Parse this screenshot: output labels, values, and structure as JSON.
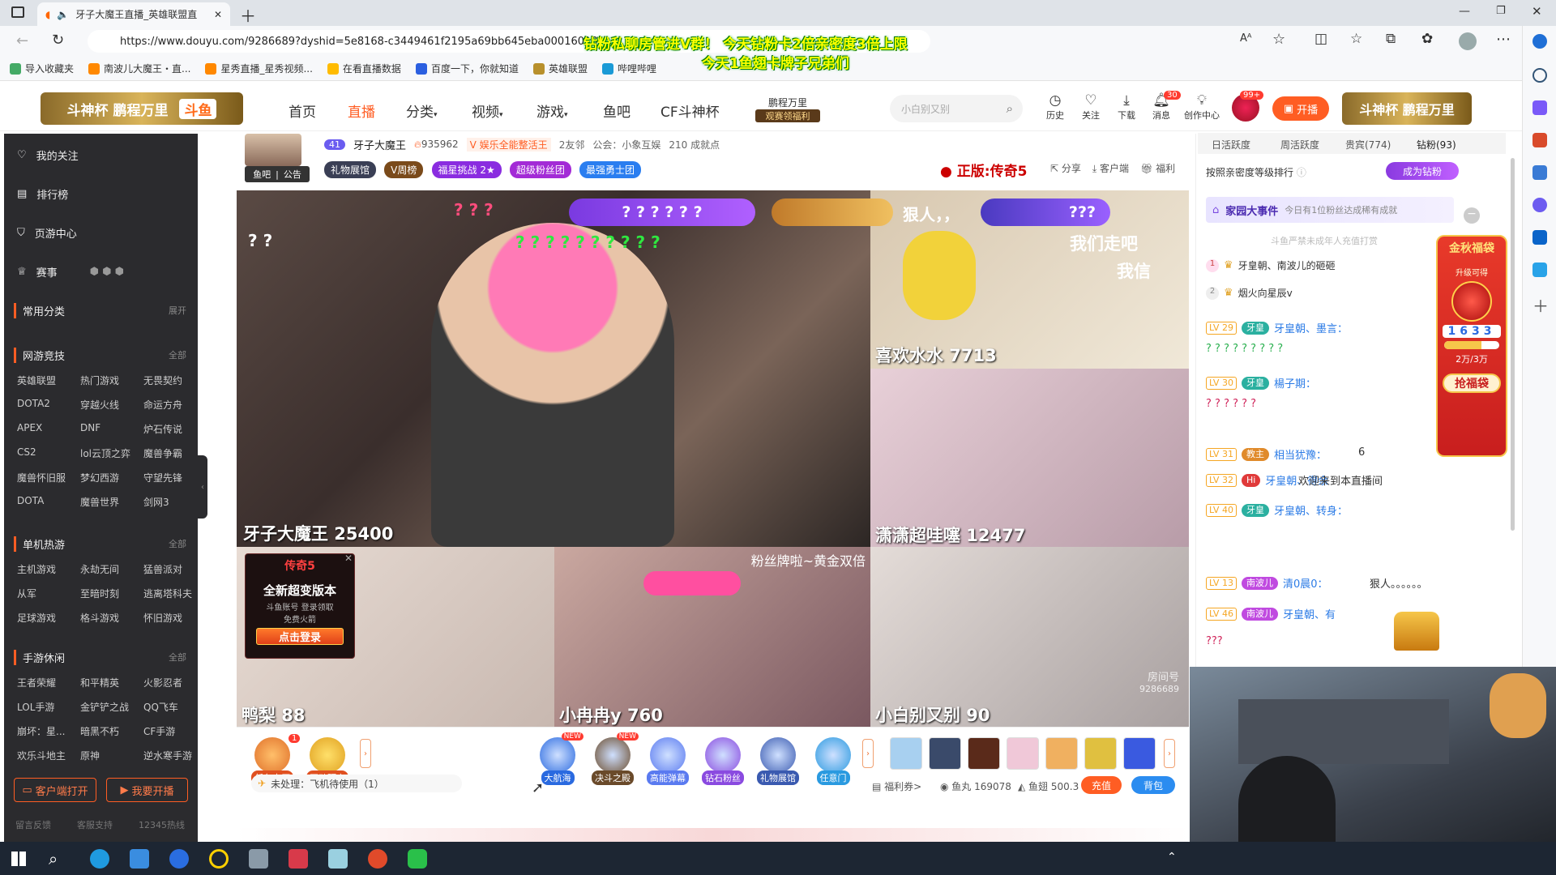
{
  "browser": {
    "tab_title": "牙子大魔王直播_英雄联盟直",
    "url": "https://www.douyu.com/9286689?dyshid=5e8168-c3449461f2195a69bb645eba00016018",
    "favorites": [
      "导入收藏夹",
      "南波儿大魔王・直...",
      "星秀直播_星秀视频...",
      "在看直播数据",
      "百度一下，你就知道",
      "英雄联盟",
      "哔哩哔哩"
    ]
  },
  "overlay": {
    "line1": "钻粉私聊房管进V群！ 今天钻粉卡2倍亲密度3倍上限",
    "line2": "今天1鱼翅卡牌子兄弟们"
  },
  "header": {
    "logo_left": "斗神杯 鹏程万里",
    "logo": "斗鱼",
    "nav": [
      "首页",
      "直播",
      "分类",
      "视频",
      "游戏",
      "鱼吧",
      "CF斗神杯"
    ],
    "promo_title": "鹏程万里",
    "promo_sub": "观赛领福利",
    "search_placeholder": "小白别又别",
    "icons": [
      "历史",
      "关注",
      "下载",
      "消息",
      "创作中心"
    ],
    "msg_badge": "30",
    "avatar_badge": "99+",
    "live_button": "开播",
    "logo_right": "斗神杯 鹏程万里"
  },
  "sidebar": {
    "top": [
      "我的关注",
      "排行榜",
      "页游中心",
      "赛事"
    ],
    "common": {
      "title": "常用分类",
      "more": "展开"
    },
    "sections": [
      {
        "title": "网游竞技",
        "more": "全部",
        "items": [
          "英雄联盟",
          "热门游戏",
          "无畏契约",
          "DOTA2",
          "穿越火线",
          "命运方舟",
          "APEX",
          "DNF",
          "炉石传说",
          "CS2",
          "lol云顶之弈",
          "魔兽争霸",
          "魔兽怀旧服",
          "梦幻西游",
          "守望先锋",
          "DOTA",
          "魔兽世界",
          "剑网3"
        ]
      },
      {
        "title": "单机热游",
        "more": "全部",
        "items": [
          "主机游戏",
          "永劫无间",
          "猛兽派对",
          "从军",
          "至暗时刻",
          "逃离塔科夫",
          "足球游戏",
          "格斗游戏",
          "怀旧游戏"
        ]
      },
      {
        "title": "手游休闲",
        "more": "全部",
        "items": [
          "王者荣耀",
          "和平精英",
          "火影忍者",
          "LOL手游",
          "金铲铲之战",
          "QQ飞车",
          "崩坏：星...",
          "暗黑不朽",
          "CF手游",
          "欢乐斗地主",
          "原神",
          "逆水寒手游"
        ]
      }
    ],
    "btn_client": "客户端打开",
    "btn_live": "我要开播",
    "footer": [
      "留言反馈",
      "客服支持",
      "12345热线"
    ]
  },
  "room": {
    "level": "41",
    "name": "牙子大魔王",
    "heat": "935962",
    "category": "娱乐全能整活王",
    "friends": "2友邻",
    "guild": "公会：小象互娱",
    "achievements": "210 成就点",
    "fishbar": "鱼吧",
    "notice": "公告",
    "tags": [
      "礼物展馆",
      "V周榜",
      "福星挑战 2★",
      "超级粉丝团",
      "最强勇士团"
    ],
    "ad_text": "正版:传奇5",
    "actions": [
      "分享",
      "客户端",
      "福利"
    ]
  },
  "video": {
    "cells": [
      {
        "name": "牙子大魔王 25400"
      },
      {
        "name": "喜欢水水 7713"
      },
      {
        "name": "潇潇超哇噻 12477"
      },
      {
        "name": "鸭梨 88"
      },
      {
        "name": "小冉冉y 760"
      },
      {
        "name": "小白别又别 90"
      }
    ],
    "top_bubble1": "? ? ? ? ? ?",
    "top_bubble2": "???",
    "q_top_left": "? ?",
    "q_green": "? ? ? ? ? ? ? ? ? ?",
    "q_red": "? ? ?",
    "text_lang": "狠人，，",
    "text_zoumen": "我们走吧",
    "text_woxin": "我信",
    "fans_banner": "粉丝牌啦~黄金双倍",
    "room_no_label": "房间号",
    "room_no": "9286689",
    "popup": {
      "title": "全新超变版本",
      "opt1": "斗鱼账号",
      "opt2": "登录领取",
      "opt3": "免费火箭",
      "btn": "点击登录",
      "logo": "传奇5"
    }
  },
  "toolbar": {
    "left_icons": [
      {
        "label": "任务大厅",
        "badge": "1"
      },
      {
        "label": "互动预言"
      }
    ],
    "middle_icons": [
      {
        "label": "大航海",
        "new": "NEW"
      },
      {
        "label": "决斗之殿",
        "new": "NEW"
      },
      {
        "label": "高能弹幕"
      },
      {
        "label": "钻石粉丝"
      },
      {
        "label": "礼物展馆"
      },
      {
        "label": "任意门"
      }
    ],
    "task": "未处理：飞机待使用（1）",
    "welfare": "福利券>",
    "fish_pill": "鱼丸 169078",
    "fish_fin": "鱼翅 500.3",
    "recharge": "充值",
    "bag": "背包"
  },
  "chat": {
    "tabs": [
      "日活跃度",
      "周活跃度",
      "贵宾(774)",
      "钻粉(93)"
    ],
    "sort": "按照亲密度等级排行",
    "become_diamond": "成为钻粉",
    "event_title": "家园大事件",
    "event_desc": "今日有1位粉丝达成稀有成就",
    "notice": "斗鱼严禁未成年人充值打赏",
    "rank": [
      {
        "no": "1",
        "name": "牙皇朝、南波儿的砸砸"
      },
      {
        "no": "2",
        "name": "烟火向星辰v"
      }
    ],
    "messages": [
      {
        "lv": "LV 29",
        "user": "牙皇朝、墨言：",
        "text": "? ? ? ? ? ? ? ? ?"
      },
      {
        "lv": "LV 30",
        "user": "楊子期：",
        "text": "? ? ? ? ? ?"
      },
      {
        "lv": "LV 31",
        "user": "相当犹豫：",
        "text": "6"
      },
      {
        "lv": "LV 32",
        "user": "牙皇朝、得余",
        "text": "欢迎来到本直播间"
      },
      {
        "lv": "LV 40",
        "user": "牙皇朝、转身：",
        "text": ""
      },
      {
        "lv": "LV 13",
        "user": "清0晨0：",
        "text": "狠人。。。。。。"
      },
      {
        "lv": "LV 46",
        "user": "牙皇朝、有",
        "text": "???"
      }
    ],
    "badge_teacher": "教主",
    "badge_nanbo": "南波儿",
    "badge_ya": "牙皇",
    "hi": "Hi",
    "fortune": {
      "title": "金秋福袋",
      "sub": "升级可得",
      "digits": "1633",
      "progress": "2万/3万",
      "btn": "抢福袋",
      "progress_value": 0.67
    }
  },
  "taskbar": {
    "apps": [
      "start",
      "search",
      "edge",
      "store",
      "k",
      "circle",
      "calc",
      "git",
      "note",
      "redapp",
      "wechat"
    ]
  }
}
